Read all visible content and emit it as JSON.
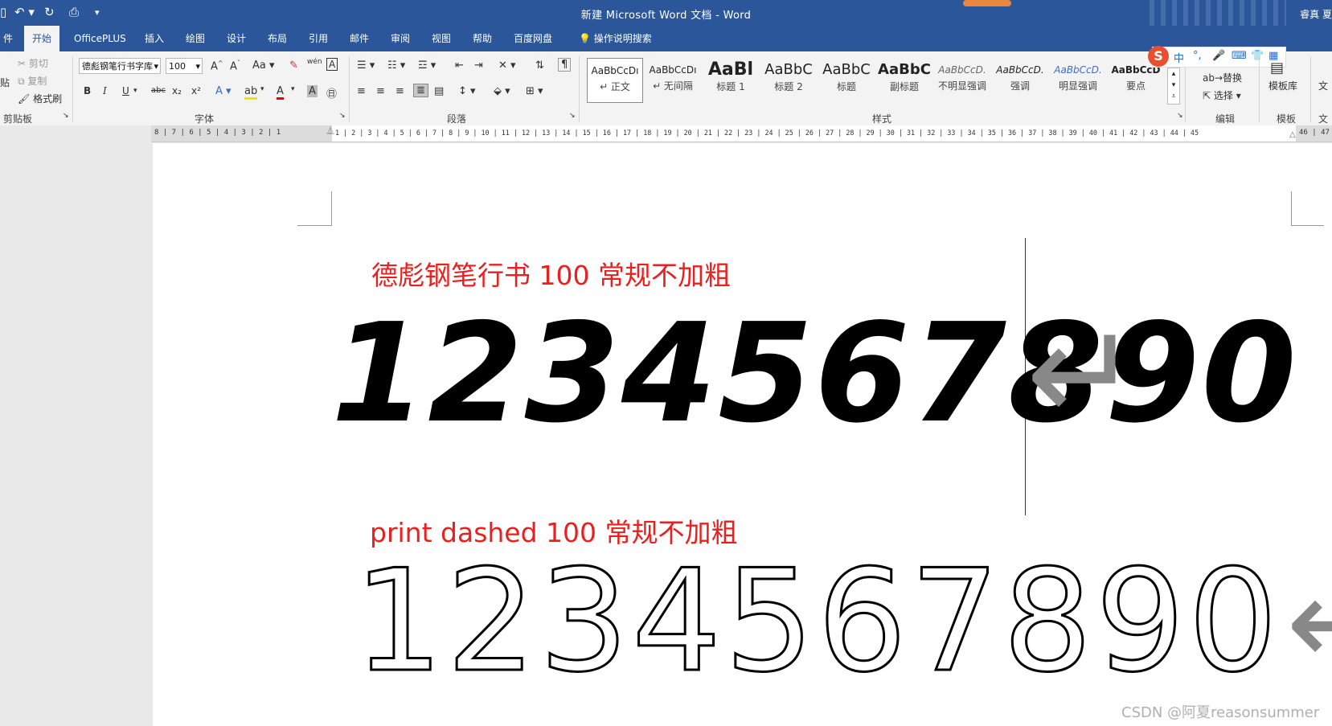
{
  "titlebar": {
    "title": "新建 Microsoft Word 文档  -  Word",
    "user": "睿真 夏",
    "undo_icon": "undo-icon",
    "redo_icon": "redo-icon",
    "preview_icon": "print-preview-icon"
  },
  "menu": {
    "tabs": [
      "件",
      "开始",
      "OfficePLUS",
      "插入",
      "绘图",
      "设计",
      "布局",
      "引用",
      "邮件",
      "审阅",
      "视图",
      "帮助",
      "百度网盘"
    ],
    "active_index": 1,
    "search": "操作说明搜索"
  },
  "clipboard": {
    "paste": "贴",
    "cut": "剪切",
    "copy": "复制",
    "format_painter": "格式刷",
    "label": "剪贴板"
  },
  "font": {
    "name": "德彪钢笔行书字库",
    "size": "100",
    "change_case": "Aa",
    "label": "字体",
    "bold": "B",
    "italic": "I",
    "underline": "U",
    "strike": "abc",
    "subscript": "x₂",
    "superscript": "x²",
    "phonetic": "wén"
  },
  "paragraph": {
    "label": "段落"
  },
  "styles": {
    "label": "样式",
    "items": [
      {
        "sample": "AaBbCcDı",
        "name": "↵ 正文"
      },
      {
        "sample": "AaBbCcDı",
        "name": "↵ 无间隔"
      },
      {
        "sample": "AaBl",
        "name": "标题 1"
      },
      {
        "sample": "AaBbC",
        "name": "标题 2"
      },
      {
        "sample": "AaBbC",
        "name": "标题"
      },
      {
        "sample": "AaBbC",
        "name": "副标题"
      },
      {
        "sample": "AaBbCcD.",
        "name": "不明显强调"
      },
      {
        "sample": "AaBbCcD.",
        "name": "强调"
      },
      {
        "sample": "AaBbCcD.",
        "name": "明显强调"
      },
      {
        "sample": "AaBbCcD",
        "name": "要点"
      }
    ]
  },
  "editing": {
    "replace": "替换",
    "select": "选择",
    "label": "编辑"
  },
  "templates": {
    "library": "模板库",
    "label": "模板",
    "extra": "文"
  },
  "ime": {
    "logo": "S",
    "lang": "中"
  },
  "ruler": {
    "left": "8 | 7 | 6 | 5 | 4 | 3 | 2 | 1",
    "right": "1 | 2 | 3 | 4 | 5 | 6 | 7 | 8 | 9 | 10 | 11 | 12 | 13 | 14 | 15 | 16 | 17 | 18 | 19 | 20 | 21 | 22 | 23 | 24 | 25 | 26 | 27 | 28 | 29 | 30 | 31 | 32 | 33 | 34 | 35 | 36 | 37 | 38 | 39 | 40 | 41 | 42 | 43 | 44 | 45",
    "tail": "46 | 47"
  },
  "document": {
    "heading1": "德彪钢笔行书 100 常规不加粗",
    "digits1": "1234567890",
    "heading2": "print dashed 100 常规不加粗",
    "digits2": "1234567890",
    "return_mark": "↵"
  },
  "watermark": "CSDN @阿夏reasonsummer",
  "colors": {
    "ribbon_blue": "#2b579a",
    "heading_red": "#e8201f"
  }
}
